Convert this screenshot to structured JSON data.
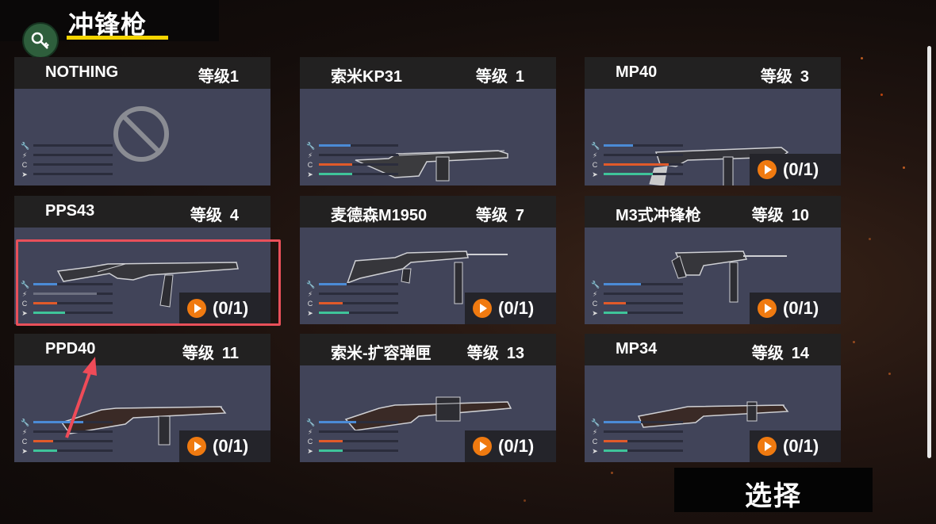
{
  "header": {
    "title": "冲锋枪"
  },
  "colors": {
    "accent_yellow": "#f5d400",
    "card_body": "#414459",
    "card_head": "#222121",
    "stat_blue": "#4b8bd6",
    "stat_orange": "#e15a2a",
    "stat_green": "#3fc49a",
    "play_orange": "#f07a10",
    "highlight_red": "#e9505a"
  },
  "weapons": [
    {
      "name": "NOTHING",
      "level_label": "等级1",
      "level_num": "",
      "unlock": "",
      "icon": "ban-icon",
      "stats": [
        0,
        0,
        0,
        0
      ]
    },
    {
      "name": "索米KP31",
      "level_label": "等级",
      "level_num": "1",
      "unlock": "",
      "icon": "smg-suomi-kp31",
      "stats": [
        40,
        0,
        42,
        42
      ]
    },
    {
      "name": "MP40",
      "level_label": "等级",
      "level_num": "3",
      "unlock": "(0/1)",
      "icon": "smg-mp40",
      "stats": [
        37,
        0,
        82,
        62
      ]
    },
    {
      "name": "PPS43",
      "level_label": "等级",
      "level_num": "4",
      "unlock": "(0/1)",
      "icon": "smg-pps43",
      "stats": [
        30,
        80,
        30,
        40
      ]
    },
    {
      "name": "麦德森M1950",
      "level_label": "等级",
      "level_num": "7",
      "unlock": "(0/1)",
      "icon": "smg-madsen-m1950",
      "stats": [
        35,
        0,
        30,
        38
      ]
    },
    {
      "name": "M3式冲锋枪",
      "level_label": "等级",
      "level_num": "10",
      "unlock": "(0/1)",
      "icon": "smg-m3",
      "stats": [
        47,
        0,
        28,
        30
      ]
    },
    {
      "name": "PPD40",
      "level_label": "等级",
      "level_num": "11",
      "unlock": "(0/1)",
      "icon": "smg-ppd40",
      "stats": [
        63,
        0,
        25,
        30
      ]
    },
    {
      "name": "索米-扩容弹匣",
      "level_label": "等级",
      "level_num": "13",
      "unlock": "(0/1)",
      "icon": "smg-suomi-drum",
      "stats": [
        47,
        0,
        30,
        30
      ]
    },
    {
      "name": "MP34",
      "level_label": "等级",
      "level_num": "14",
      "unlock": "(0/1)",
      "icon": "smg-mp34",
      "stats": [
        47,
        0,
        30,
        30
      ]
    }
  ],
  "select_button": "选择"
}
